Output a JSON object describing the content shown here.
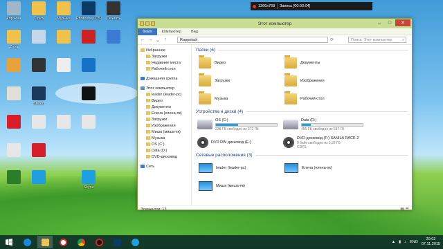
{
  "desktop": {
    "icons": [
      {
        "label": "Корзина",
        "color": "#9fb7c8"
      },
      {
        "label": "Clovis",
        "color": "#f0c24c"
      },
      {
        "label": "Музыка",
        "color": "#f0c24c"
      },
      {
        "label": "Photoshop CS6 x64",
        "color": "#0b3a66"
      },
      {
        "label": "Скачать",
        "color": "#333"
      },
      {
        "label": "Zona",
        "color": "#f0c24c"
      },
      {
        "label": "",
        "color": "#c5d7e8"
      },
      {
        "label": "",
        "color": "#f0c24c"
      },
      {
        "label": "",
        "color": "#cc2222"
      },
      {
        "label": "",
        "color": "#3b7bd4"
      },
      {
        "label": "",
        "color": "#e8a23b"
      },
      {
        "label": "",
        "color": "#333"
      },
      {
        "label": "",
        "color": "#eee"
      },
      {
        "label": "",
        "color": "#1573c7"
      },
      {
        "label": "",
        "color": "#e3dfd6"
      },
      {
        "label": "Steam",
        "color": "#1b3a5c"
      },
      {
        "label": "",
        "color": "#111"
      },
      {
        "label": "",
        "color": "#d81e28"
      },
      {
        "label": "",
        "color": "#e7e7e7"
      },
      {
        "label": "",
        "color": "#e7e7e7"
      },
      {
        "label": "",
        "color": "#e7e7e7"
      },
      {
        "label": "",
        "color": "#e7e7e7"
      },
      {
        "label": "",
        "color": "#d81e28"
      },
      {
        "label": "",
        "color": "#2d7c2a"
      },
      {
        "label": "",
        "color": "#1ea0e0"
      },
      {
        "label": "Skype",
        "color": "#1ea0e0"
      }
    ]
  },
  "recorder": {
    "resolution": "1366x768",
    "status": "Запись [00:03:04]"
  },
  "window": {
    "title": "Этот компьютер",
    "ribbon_tabs": [
      "Файл",
      "Компьютер",
      "Вид"
    ],
    "address": "Rappotaol",
    "search_placeholder": "Поиск: Этот компьютер",
    "sidebar": [
      {
        "label": "Избранное",
        "kind": "head"
      },
      {
        "label": "Загрузки",
        "kind": "sub"
      },
      {
        "label": "Недавние места",
        "kind": "sub"
      },
      {
        "label": "Рабочий стол",
        "kind": "sub"
      },
      {
        "label": "Домашняя группа",
        "kind": "gap"
      },
      {
        "label": "Этот компьютер",
        "kind": "gap"
      },
      {
        "label": "leader (leader-pc)",
        "kind": "sub"
      },
      {
        "label": "Видео",
        "kind": "sub"
      },
      {
        "label": "Документы",
        "kind": "sub"
      },
      {
        "label": "Елена (елена-пк)",
        "kind": "sub"
      },
      {
        "label": "Загрузки",
        "kind": "sub"
      },
      {
        "label": "Изображения",
        "kind": "sub"
      },
      {
        "label": "Миша (миша-пк)",
        "kind": "sub"
      },
      {
        "label": "Музыка",
        "kind": "sub"
      },
      {
        "label": "OS (C:)",
        "kind": "sub"
      },
      {
        "label": "Data (D:)",
        "kind": "sub"
      },
      {
        "label": "DVD-дисковод",
        "kind": "sub"
      },
      {
        "label": "Сеть",
        "kind": "gap"
      }
    ],
    "folders_header": "Папки (6)",
    "folders": [
      "Видео",
      "Документы",
      "Загрузки",
      "Изображения",
      "Музыка",
      "Рабочий стол"
    ],
    "devices_header": "Устройства и диски (4)",
    "drives": [
      {
        "name": "OS (C:)",
        "free": "238 ГБ свободно из 372 ГБ",
        "fill": 0.36
      },
      {
        "name": "Data (D:)",
        "free": "455 ГБ свободно из 537 ГБ",
        "fill": 0.15
      }
    ],
    "optical": [
      {
        "name": "DVD RW дисковод (E:)",
        "sub": ""
      },
      {
        "name": "DVD-дисковод (F:) SANILA RACK 2",
        "sub": "0 байт свободно из 3,32 ГБ\nCDFS"
      }
    ],
    "network_header": "Сетевые расположения (3)",
    "network": [
      "leader (leader-pc)",
      "Елена (елена-пк)",
      "Миша (миша-пк)"
    ],
    "status": "Элементов: 13"
  },
  "taskbar": {
    "lang": "ENG",
    "time": "20:02",
    "date": "07.11.2015"
  }
}
